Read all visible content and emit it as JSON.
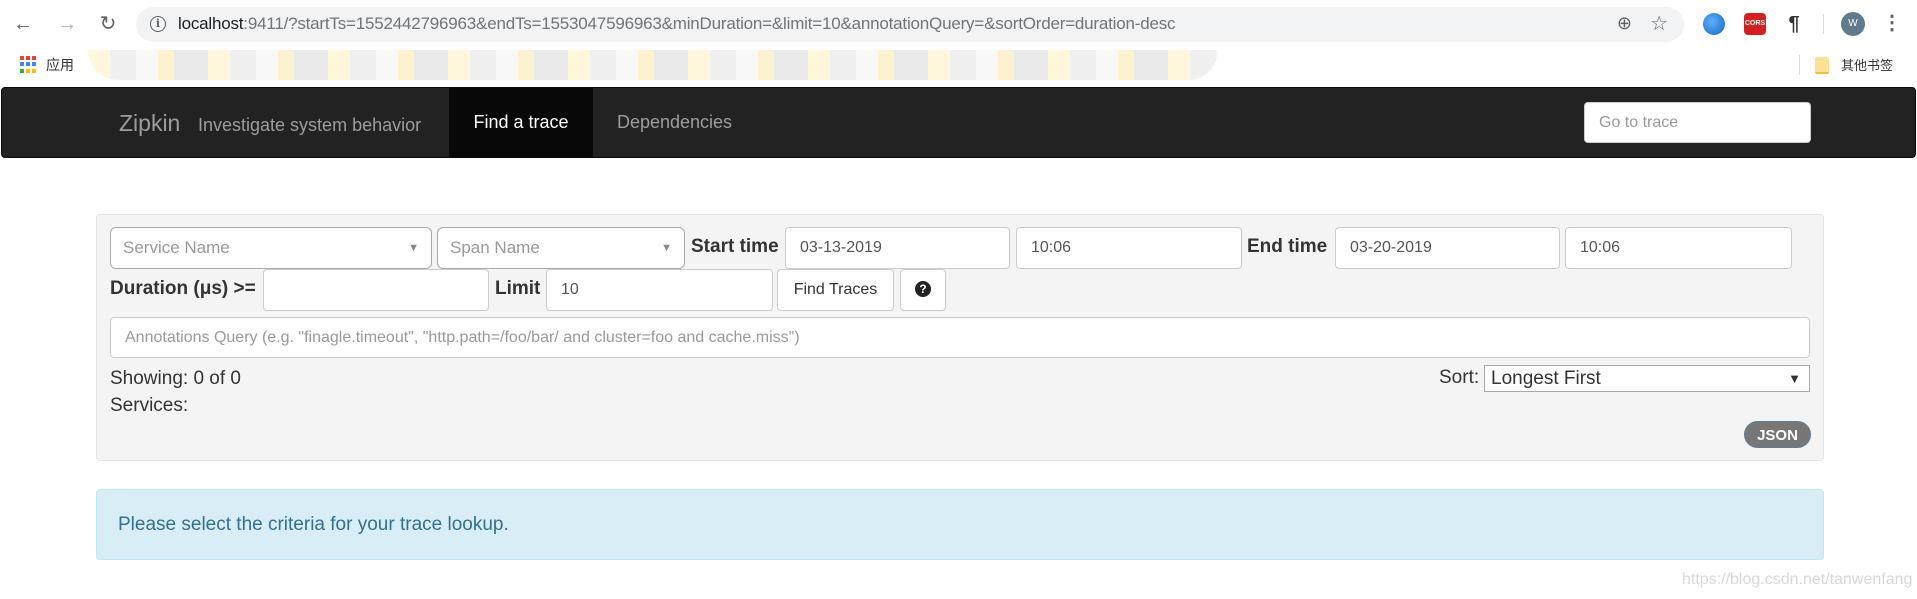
{
  "browser": {
    "url_host": "localhost",
    "url_rest": ":9411/?startTs=1552442796963&endTs=1553047596963&minDuration=&limit=10&annotationQuery=&sortOrder=duration-desc",
    "icons": {
      "back": "←",
      "forward": "→",
      "reload": "↻",
      "info": "i",
      "zoom": "⊕",
      "star": "☆",
      "extension_cors": "CORS",
      "extension_para": "¶",
      "avatar_letter": "W",
      "menu": "⋮"
    },
    "bookmarks": {
      "apps_label": "应用",
      "other_bookmarks": "其他书签"
    }
  },
  "navbar": {
    "brand": "Zipkin",
    "tagline": "Investigate system behavior",
    "tabs": [
      {
        "label": "Find a trace",
        "active": true
      },
      {
        "label": "Dependencies",
        "active": false
      }
    ],
    "goto_trace_placeholder": "Go to trace"
  },
  "search": {
    "service_name_placeholder": "Service Name",
    "span_name_placeholder": "Span Name",
    "caret": "▼",
    "start_time_label": "Start time",
    "start_date": "03-13-2019",
    "start_clock": "10:06",
    "end_time_label": "End time",
    "end_date": "03-20-2019",
    "end_clock": "10:06",
    "duration_label": "Duration (μs) >=",
    "duration_value": "",
    "limit_label": "Limit",
    "limit_value": "10",
    "find_button": "Find Traces",
    "help_icon": "?",
    "annotations_placeholder": "Annotations Query (e.g. \"finagle.timeout\", \"http.path=/foo/bar/ and cluster=foo and cache.miss\")",
    "showing": "Showing: 0 of 0",
    "services": "Services:",
    "sort_label": "Sort:",
    "sort_value": "Longest First",
    "json_button": "JSON"
  },
  "alert": {
    "message": "Please select the criteria for your trace lookup."
  },
  "watermark": "https://blog.csdn.net/tanwenfang",
  "colors": {
    "navbar_bg": "#222222",
    "navbar_active": "#080808",
    "alert_bg": "#d9edf7",
    "alert_text": "#31708f",
    "panel_bg": "#f4f4f4"
  }
}
